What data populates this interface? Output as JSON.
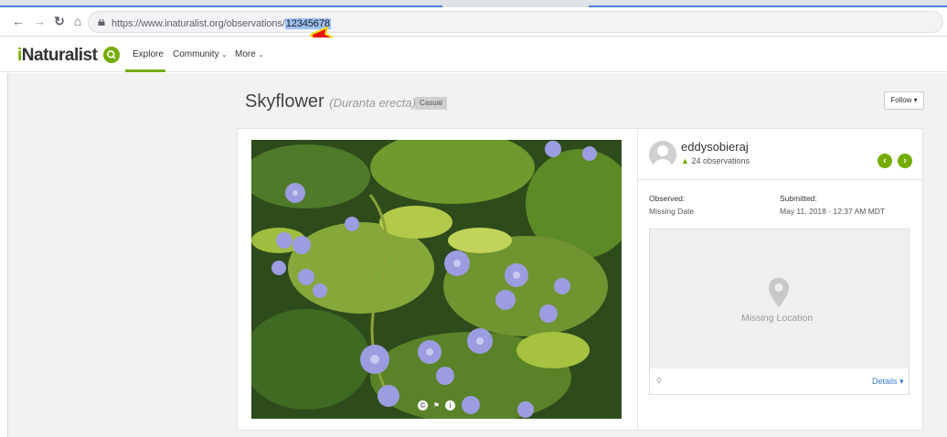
{
  "browser": {
    "url_base": "https://www.inaturalist.org/observations/",
    "url_selected": "12345678",
    "back_icon": "back-arrow-icon",
    "forward_icon": "forward-arrow-icon",
    "reload_icon": "reload-icon",
    "home_icon": "home-icon",
    "lock_icon": "lock-icon"
  },
  "annotation": {
    "arrow_color": "#e8120c",
    "arrow_outline": "#f5d800"
  },
  "nav": {
    "logo_prefix": "i",
    "logo_rest": "Naturalist",
    "explore": "Explore",
    "community": "Community",
    "more": "More",
    "accent": "#74ac00"
  },
  "observation": {
    "common_name": "Skyflower",
    "scientific_name": "(Duranta erecta)",
    "quality_grade": "Casual",
    "follow_label": "Follow"
  },
  "observer": {
    "username": "eddysobieraj",
    "observations_count": "24 observations"
  },
  "meta": {
    "observed_label": "Observed:",
    "observed_value": "Missing Date",
    "submitted_label": "Submitted:",
    "submitted_value": "May 11, 2018 · 12:37 AM MDT"
  },
  "map": {
    "missing_location": "Missing Location",
    "details_label": "Details"
  }
}
